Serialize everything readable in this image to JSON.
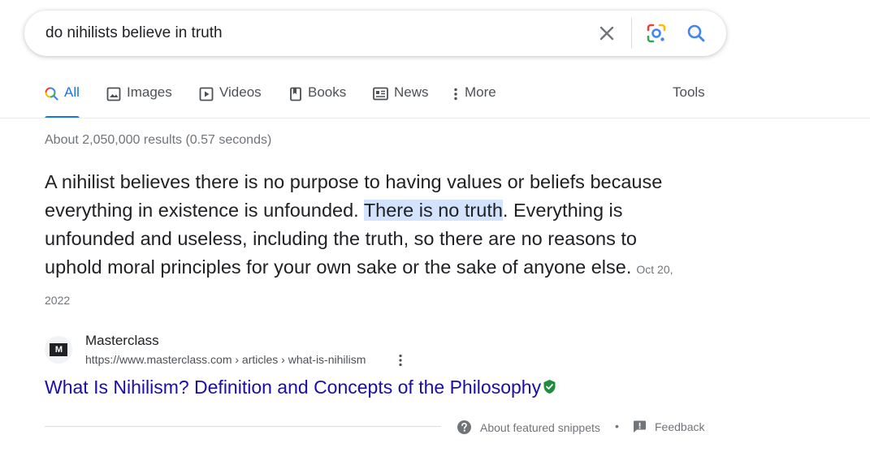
{
  "search": {
    "query": "do nihilists believe in truth",
    "clear_icon": "close-icon",
    "lens_icon": "google-lens-icon",
    "search_icon": "search-icon"
  },
  "tabs": [
    {
      "label": "All",
      "icon": "search-icon",
      "active": true
    },
    {
      "label": "Images",
      "icon": "image-icon"
    },
    {
      "label": "Videos",
      "icon": "play-icon"
    },
    {
      "label": "Books",
      "icon": "book-icon"
    },
    {
      "label": "News",
      "icon": "news-icon"
    },
    {
      "label": "More",
      "icon": "more-vertical-icon"
    }
  ],
  "tools_label": "Tools",
  "stats": "About 2,050,000 results (0.57 seconds)",
  "snippet": {
    "text_before": "A nihilist believes there is no purpose to having values or beliefs because everything in existence is unfounded. ",
    "highlight": "There is no truth",
    "text_after": ". Everything is unfounded and useless, including the truth, so there are no reasons to uphold moral principles for your own sake or the sake of anyone else.",
    "date": "Oct 20, 2022"
  },
  "result": {
    "favicon_text": "M",
    "site_name": "Masterclass",
    "url": "https://www.masterclass.com › articles › what-is-nihilism",
    "title": "What Is Nihilism? Definition and Concepts of the Philosophy"
  },
  "footer": {
    "about_label": "About featured snippets",
    "separator": "•",
    "feedback_label": "Feedback"
  },
  "colors": {
    "accent": "#1a73e8",
    "link": "#1a0dab",
    "highlight": "#d3e3fd",
    "verified": "#1e8e3e"
  }
}
